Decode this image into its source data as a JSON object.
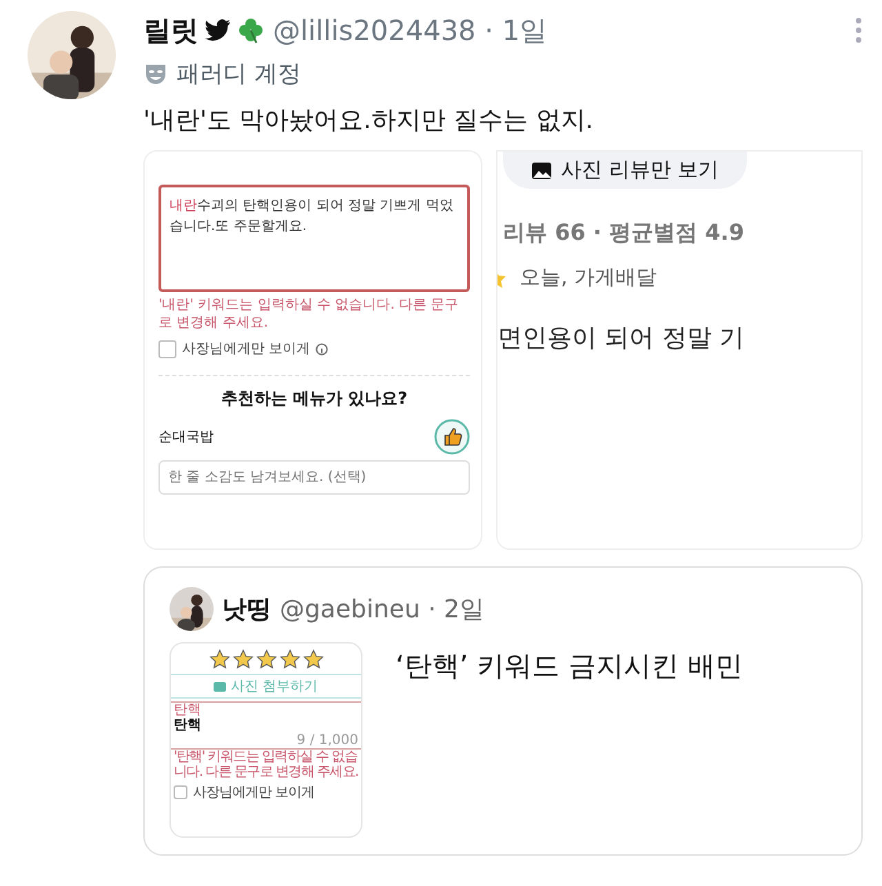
{
  "tweet": {
    "name": "릴릿",
    "meta": "@lillis2024438 · 1일",
    "label": "패러디 계정",
    "text": "'내란'도 막아놨어요.하지만 질수는 없지.",
    "review_form": {
      "highlight": "내란",
      "review_text": "수괴의 탄핵인용이 되어 정말 기쁘게 먹었습니다.또 주문할게요.",
      "error": "'내란' 키워드는 입력하실 수 없습니다. 다른 문구로 변경해 주세요.",
      "owner_only": {
        "label": "사장님에게만 보이게",
        "checked": false
      },
      "question": "추천하는 메뉴가 있나요?",
      "menu": {
        "name": "순대국밥",
        "liked": true
      },
      "placeholder": "한 줄 소감도 남겨보세요. (선택)"
    },
    "review_list": {
      "button": "사진 리뷰만 보기",
      "stats": "리뷰 66 · 평균별점 4.9",
      "meta": "오늘, 가게배달",
      "excerpt": "면인용이 되어 정말 기"
    },
    "quote": {
      "name": "낫띵",
      "meta": "@gaebineu · 2일",
      "text": "‘탄핵’ 키워드 금지시킨 배민",
      "thumbnail": {
        "stars": 5,
        "attach": "사진 첨부하기",
        "field_label": "탄핵",
        "value": "탄핵",
        "counter": "9 / 1,000",
        "error": "'탄핵' 키워드는 입력하실 수 없습니다. 다른 문구로 변경해 주세요.",
        "owner_only": {
          "label": "사장님에게만 보이게",
          "checked": false
        }
      }
    }
  }
}
